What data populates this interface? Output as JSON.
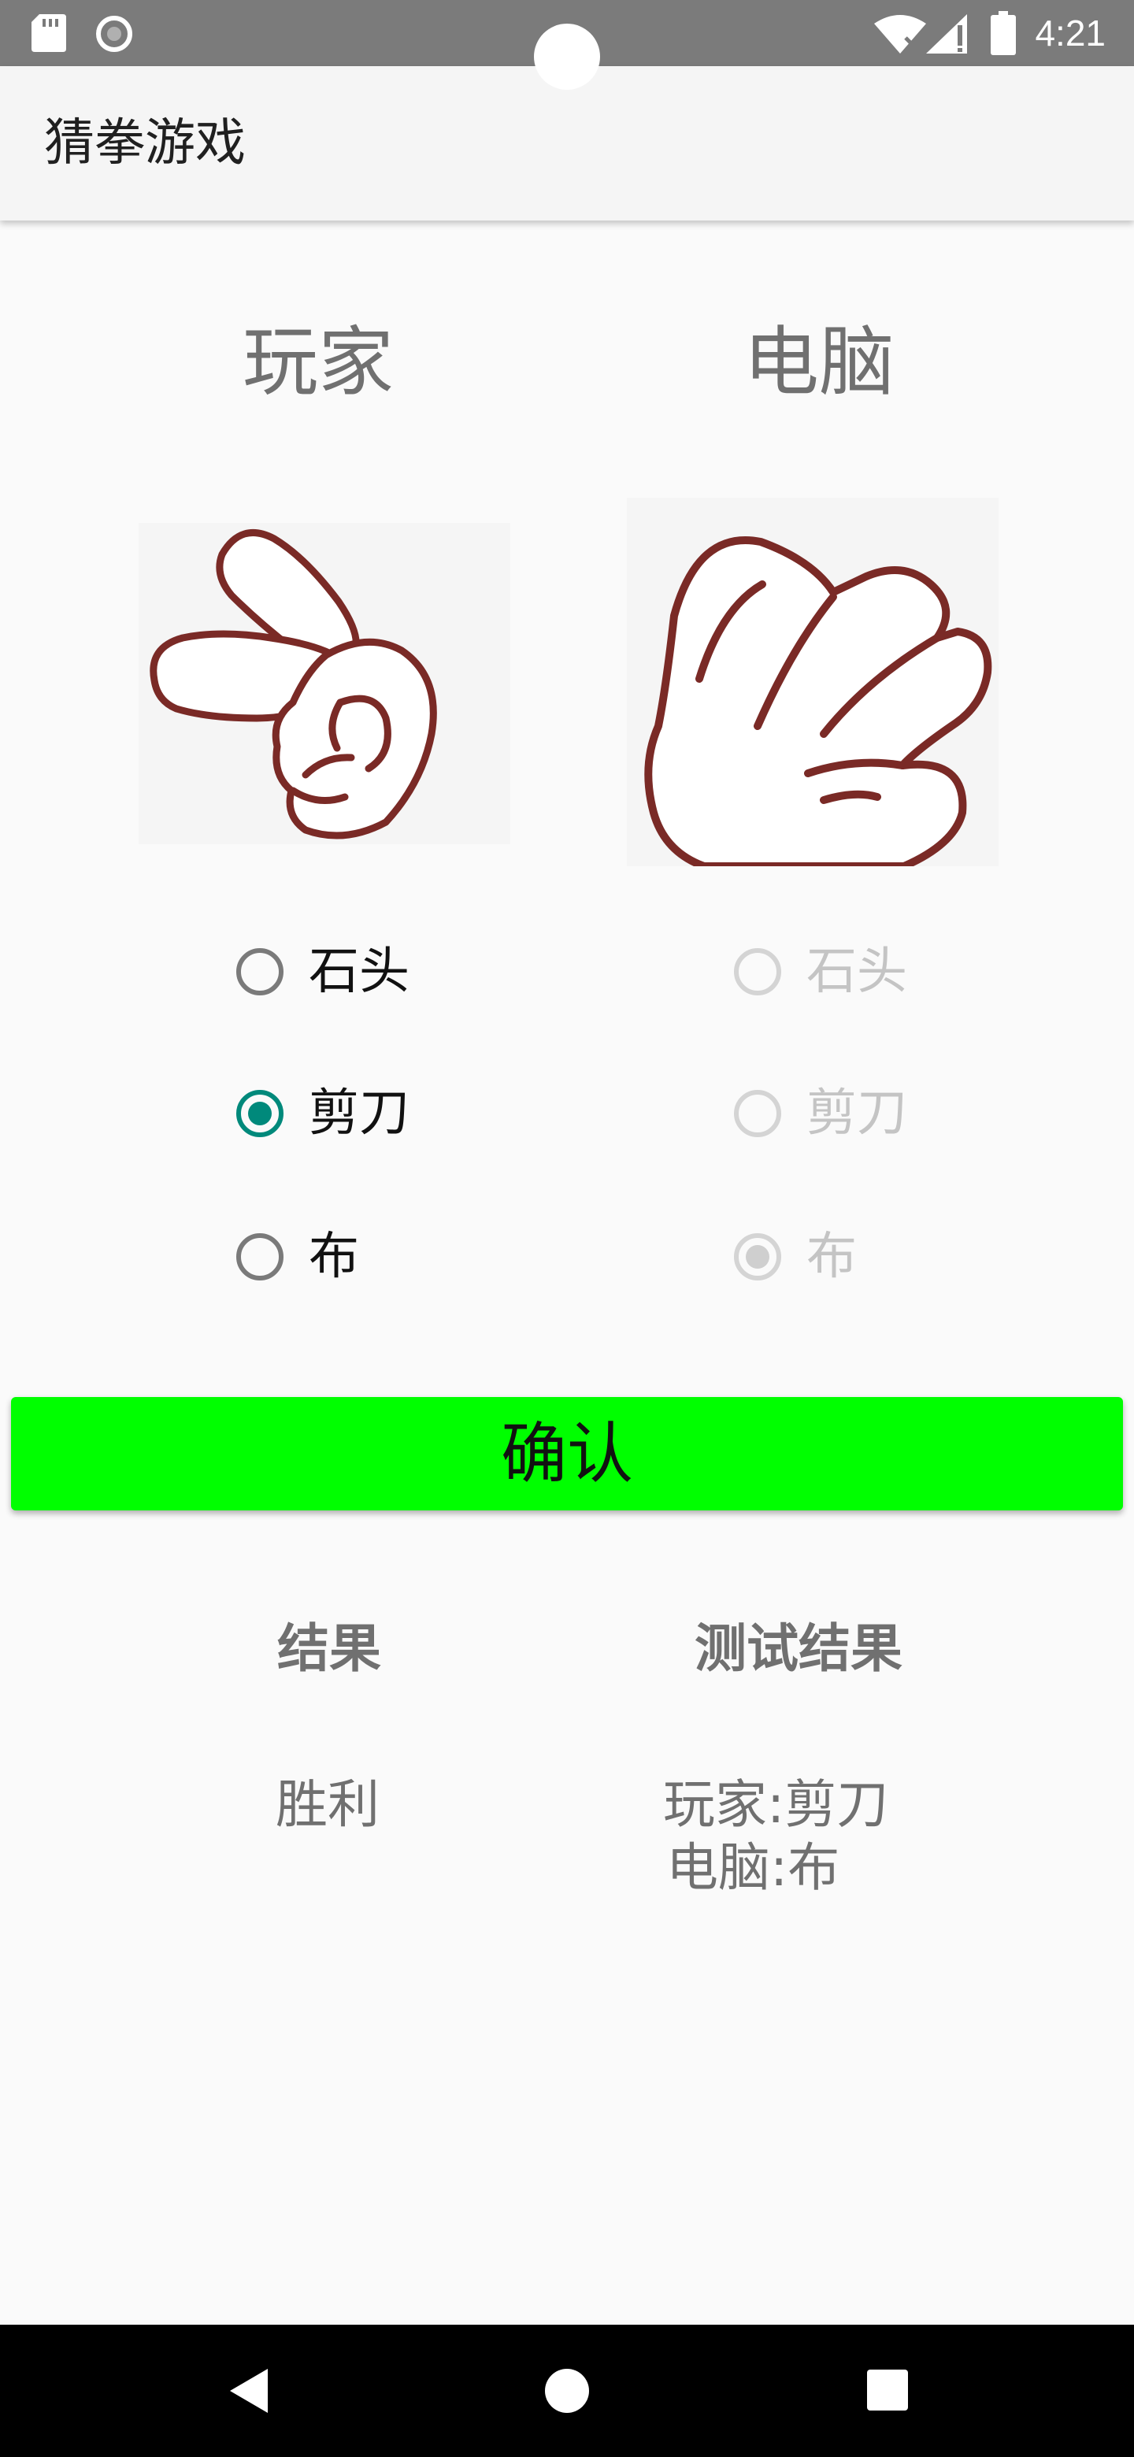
{
  "status_bar": {
    "time": "4:21",
    "icons": [
      "sd-card-icon",
      "record-icon",
      "wifi-icon",
      "signal-icon",
      "battery-icon"
    ]
  },
  "app_bar": {
    "title": "猜拳游戏"
  },
  "columns": {
    "player_heading": "玩家",
    "computer_heading": "电脑"
  },
  "player": {
    "hand_image": "scissors-hand-icon",
    "options": [
      {
        "label": "石头",
        "checked": false
      },
      {
        "label": "剪刀",
        "checked": true
      },
      {
        "label": "布",
        "checked": false
      }
    ]
  },
  "computer": {
    "hand_image": "paper-hand-icon",
    "enabled": false,
    "options": [
      {
        "label": "石头",
        "checked": false
      },
      {
        "label": "剪刀",
        "checked": false
      },
      {
        "label": "布",
        "checked": true
      }
    ]
  },
  "confirm_button": {
    "label": "确认",
    "color": "#00ff00"
  },
  "results": {
    "result_heading": "结果",
    "result_value": "胜利",
    "test_heading": "测试结果",
    "test_line1": "玩家:剪刀",
    "test_line2": "电脑:布"
  },
  "colors": {
    "accent": "#00897b",
    "status_bar": "#7b7b7b",
    "nav_bar": "#000000"
  },
  "nav_bar": {
    "buttons": [
      "back-icon",
      "home-icon",
      "recents-icon"
    ]
  }
}
